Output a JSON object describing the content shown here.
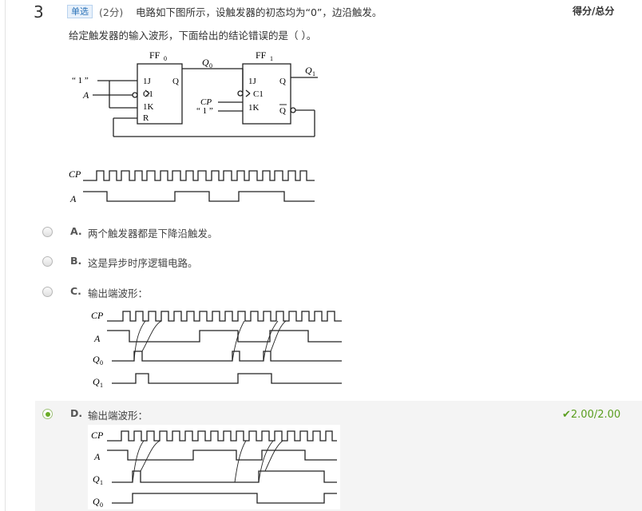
{
  "question": {
    "number": "3",
    "type_tag": "单选",
    "points": "(2分)",
    "stem_line1": "电路如下图所示，设触发器的初态均为“0”，边沿触发。",
    "stem_line2": "给定触发器的输入波形，下面给出的结论错误的是（   ）。",
    "score_header": "得分/总分"
  },
  "circuit": {
    "ff0_title": "FF",
    "ff0_sub": "0",
    "ff1_title": "FF",
    "ff1_sub": "1",
    "pin_1j": "1J",
    "pin_c1": "C1",
    "pin_1k": "1K",
    "pin_r": "R",
    "pin_q": "Q",
    "pin_qbar": "Q",
    "input_one": "“ 1 ”",
    "input_a": "A",
    "input_cp": "CP",
    "q0_label": "Q",
    "q0_sub": "0",
    "q1_label": "Q",
    "q1_sub": "1"
  },
  "input_waveform": {
    "cp_label": "CP",
    "a_label": "A"
  },
  "options": [
    {
      "letter": "A.",
      "text": "两个触发器都是下降沿触发。",
      "selected": false
    },
    {
      "letter": "B.",
      "text": "这是异步时序逻辑电路。",
      "selected": false
    },
    {
      "letter": "C.",
      "text": "输出端波形：",
      "selected": false,
      "wave_labels": [
        "CP",
        "A",
        "Q",
        "Q"
      ],
      "wave_subs": [
        "",
        "",
        "0",
        "1"
      ]
    },
    {
      "letter": "D.",
      "text": "输出端波形：",
      "selected": true,
      "wave_labels": [
        "CP",
        "A",
        "Q",
        "Q"
      ],
      "wave_subs": [
        "",
        "",
        "1",
        "0"
      ]
    }
  ],
  "result": {
    "mark": "✔",
    "score": "2.00/2.00",
    "color": "#5a9e1f"
  }
}
